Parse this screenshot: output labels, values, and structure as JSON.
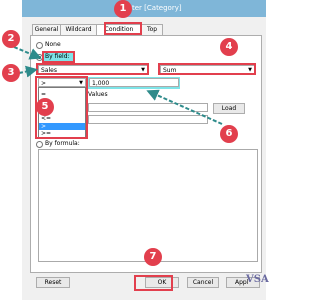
{
  "window": {
    "title": "ter [Category]"
  },
  "tabs": [
    {
      "label": "General",
      "active": false
    },
    {
      "label": "Wildcard",
      "active": false
    },
    {
      "label": "Condition",
      "active": true
    },
    {
      "label": "Top",
      "active": false
    }
  ],
  "condition": {
    "options": [
      {
        "label": "None",
        "selected": false
      },
      {
        "label": "By field:",
        "selected": true
      },
      {
        "label": "By formula:",
        "selected": false
      }
    ],
    "field_value": "Sales",
    "aggregation_value": "Sum",
    "operator_value": ">",
    "value_input": "1,000",
    "range_label": "Values",
    "load_button": "Load",
    "operator_options": [
      "=",
      "<>",
      "<",
      "<=",
      ">",
      ">="
    ],
    "operator_list_selected_index": 4
  },
  "buttons": {
    "reset": "Reset",
    "ok": "OK",
    "cancel": "Cancel",
    "apply": "Appl"
  },
  "annotations": {
    "badges": [
      "1",
      "2",
      "3",
      "4",
      "5",
      "6",
      "7"
    ],
    "highlight_color": "#e23f4d",
    "cyan_color": "#7ee4e8",
    "arrow_color": "#2e8b8b"
  },
  "logo": {
    "text": "VSA"
  }
}
